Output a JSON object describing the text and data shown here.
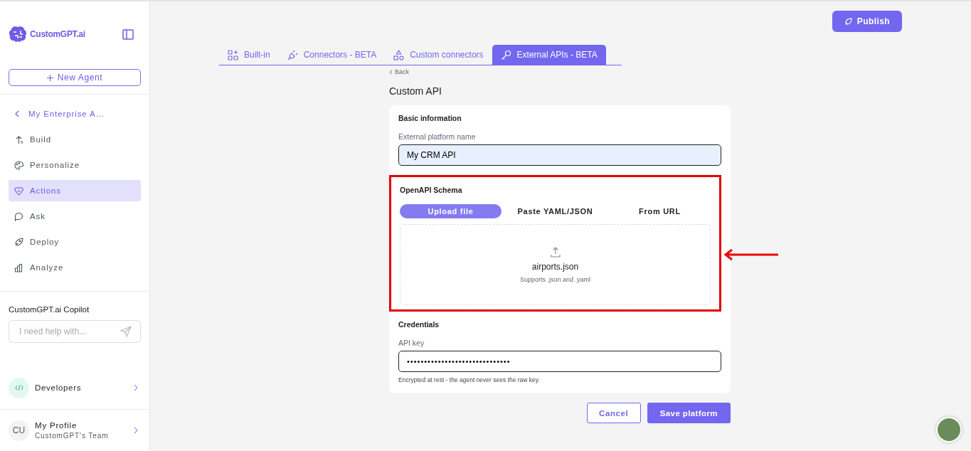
{
  "sidebar": {
    "brand": "CustomGPT.ai",
    "new_agent": "New Agent",
    "back_item": "My Enterprise A...",
    "items": [
      {
        "label": "Build",
        "selected": false
      },
      {
        "label": "Personalize",
        "selected": false
      },
      {
        "label": "Actions",
        "selected": true
      },
      {
        "label": "Ask",
        "selected": false
      },
      {
        "label": "Deploy",
        "selected": false
      },
      {
        "label": "Analyze",
        "selected": false
      }
    ],
    "copilot": {
      "title": "CustomGPT.ai Copilot",
      "placeholder": "I need help with..."
    },
    "developers": "Developers",
    "profile": {
      "initials": "CU",
      "name": "My Profile",
      "team": "CustomGPT's Team"
    }
  },
  "publish": "Publish",
  "tabs": [
    {
      "label": "Built-in",
      "selected": false
    },
    {
      "label": "Connectors - BETA",
      "selected": false
    },
    {
      "label": "Custom connectors",
      "selected": false
    },
    {
      "label": "External APIs - BETA",
      "selected": true
    }
  ],
  "back": "Back",
  "title": "Custom API",
  "basic": {
    "heading": "Basic information",
    "label": "External platform name",
    "value": "My CRM API"
  },
  "schema": {
    "heading": "OpenAPI Schema",
    "highlighted": true,
    "modes": [
      {
        "label": "Upload file",
        "selected": true
      },
      {
        "label": "Paste YAML/JSON",
        "selected": false
      },
      {
        "label": "From URL",
        "selected": false
      }
    ],
    "file": "airports.json",
    "hint": "Supports .json and .yaml"
  },
  "credentials": {
    "heading": "Credentials",
    "label": "API key",
    "value": "••••••••••••••••••••••••••••••",
    "note": "Encrypted at rest - the agent never sees the raw key."
  },
  "buttons": {
    "cancel": "Cancel",
    "save": "Save platform"
  }
}
